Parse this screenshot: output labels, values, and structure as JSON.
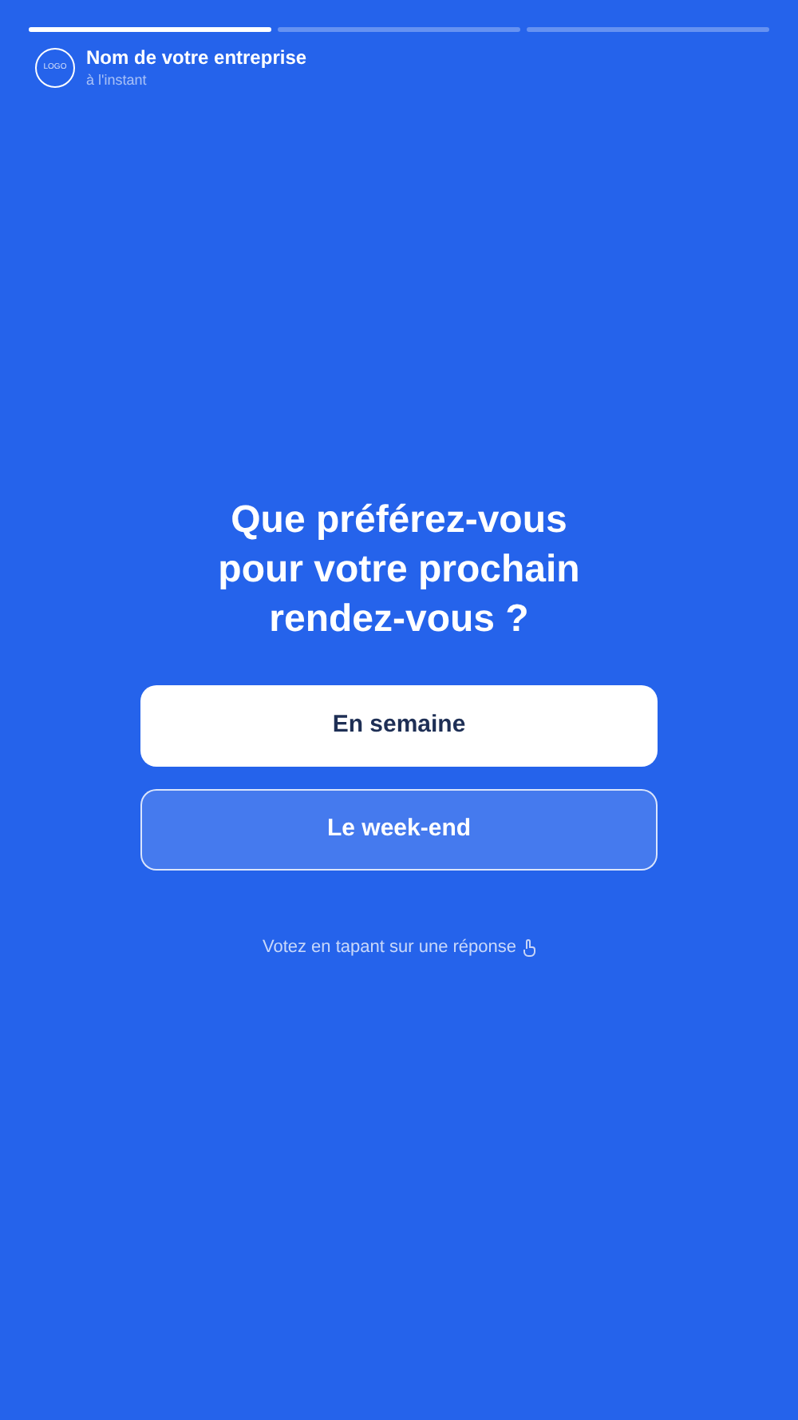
{
  "progress": [
    {
      "level": 1
    },
    {
      "level": 0
    },
    {
      "level": 0
    }
  ],
  "header": {
    "logo": "LOGO",
    "name": "Nom de votre entreprise",
    "time": "à l'instant"
  },
  "question": "Que préférez-vous pour votre prochain rendez-vous ?",
  "options": [
    {
      "label": "En semaine",
      "selected": true
    },
    {
      "label": "Le week-end",
      "selected": false
    }
  ],
  "hint": "Votez en tapant sur une réponse"
}
